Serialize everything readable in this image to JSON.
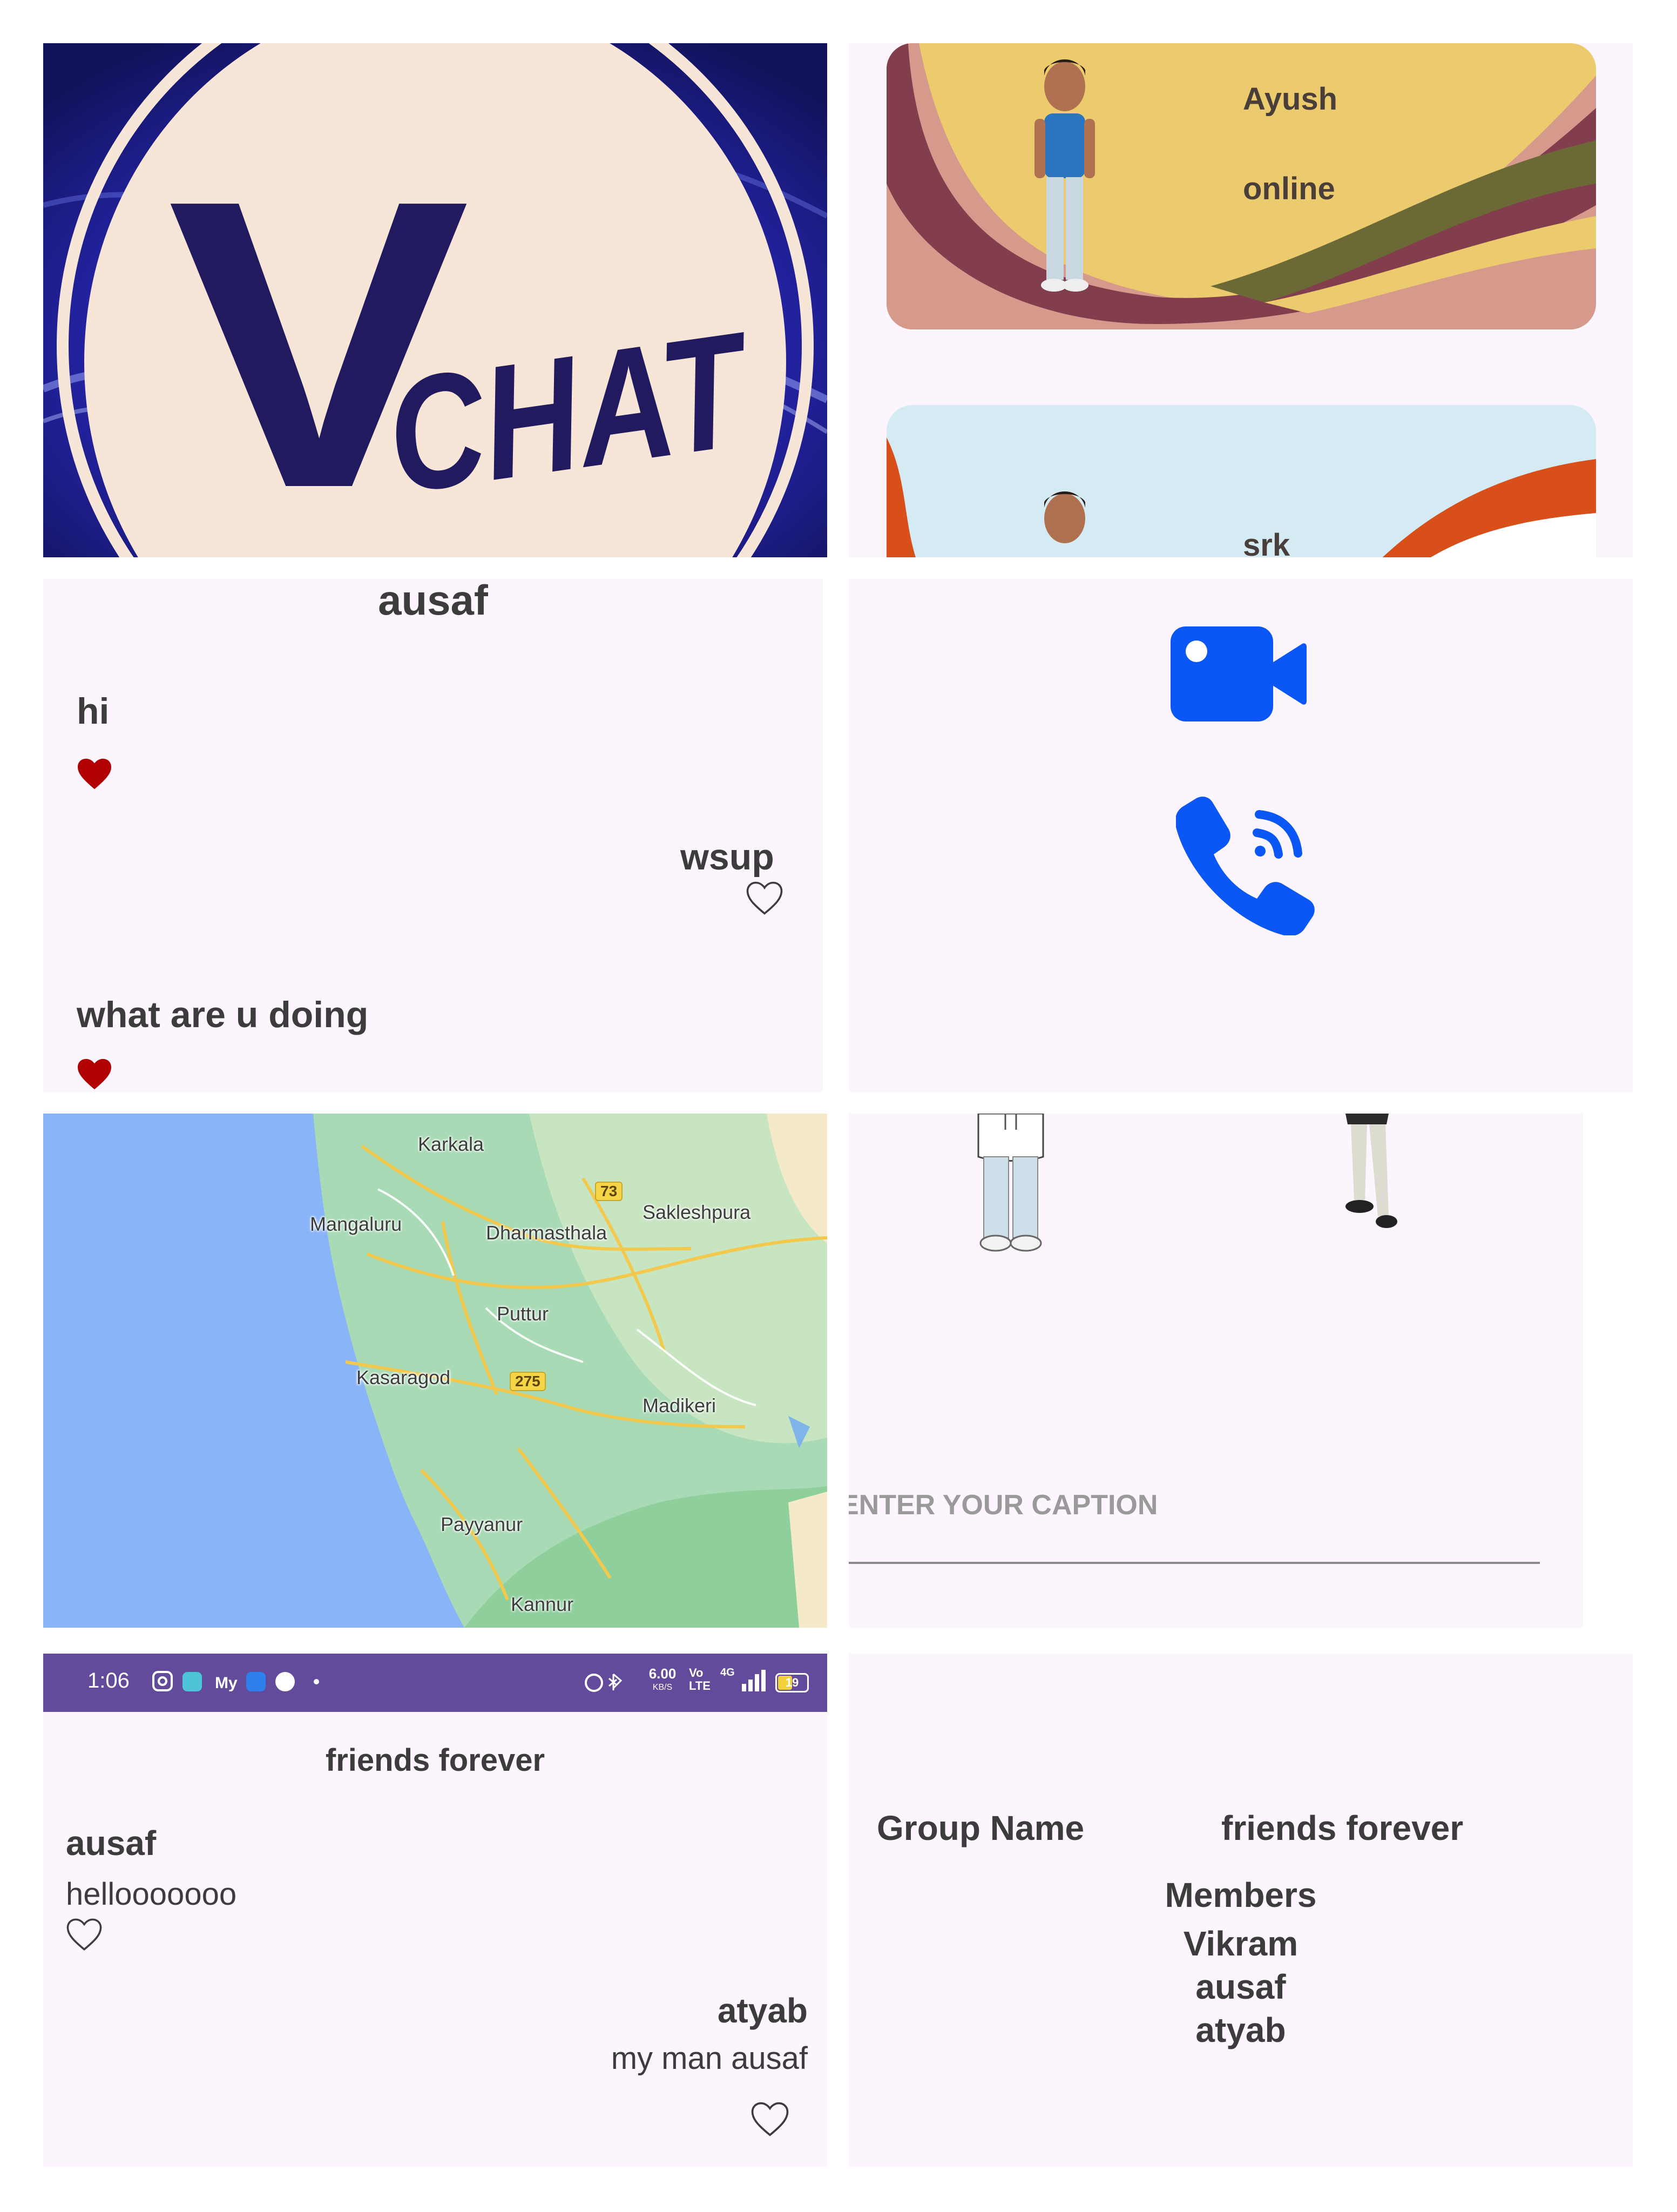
{
  "logo": {
    "text_v": "V",
    "text_chat": "CHAT"
  },
  "contacts": [
    {
      "name": "Ayush",
      "status": "online"
    },
    {
      "name": "srk"
    }
  ],
  "chat": {
    "title": "ausaf",
    "messages": [
      {
        "text": "hi",
        "side": "left",
        "liked": true
      },
      {
        "text": "wsup",
        "side": "right",
        "liked": false
      },
      {
        "text": "what are u doing",
        "side": "left",
        "liked": true
      }
    ]
  },
  "call": {
    "video_icon": "video-camera-icon",
    "voice_icon": "phone-call-icon",
    "accent": "#0b57f5"
  },
  "map": {
    "places": [
      "Karkala",
      "Mangaluru",
      "Sakleshpura",
      "Dharmasthala",
      "Puttur",
      "Kasaragod",
      "Madikeri",
      "Payyanur",
      "Kannur"
    ],
    "highways": [
      "73",
      "275"
    ]
  },
  "caption": {
    "placeholder": "ENTER YOUR CAPTION"
  },
  "group_chat": {
    "status_bar": {
      "time": "1:06",
      "net_speed_value": "6.00",
      "net_speed_unit": "KB/S",
      "net_type": "4G",
      "battery": "19"
    },
    "title": "friends forever",
    "messages": [
      {
        "sender": "ausaf",
        "text": "hellooooooo",
        "side": "left"
      },
      {
        "sender": "atyab",
        "text": "my man ausaf",
        "side": "right"
      }
    ]
  },
  "group_info": {
    "name_label": "Group Name",
    "name_value": "friends forever",
    "members_label": "Members",
    "members": [
      "Vikram",
      "ausaf",
      "atyab"
    ]
  },
  "colors": {
    "brand_navy": "#221a5e",
    "logo_cream": "#f7e6d8",
    "status_bar": "#634b9c",
    "heart_red": "#b00000"
  }
}
